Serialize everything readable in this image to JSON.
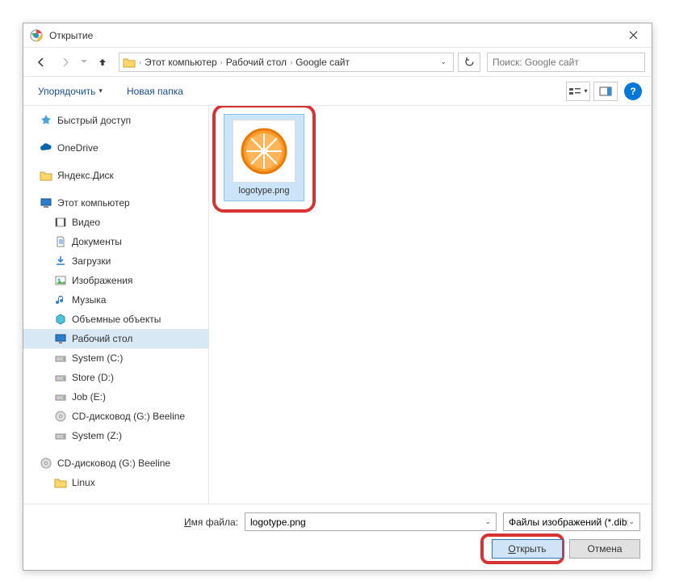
{
  "title": "Открытие",
  "breadcrumbs": [
    "Этот компьютер",
    "Рабочий стол",
    "Google сайт"
  ],
  "search_placeholder": "Поиск: Google сайт",
  "toolbar": {
    "organize": "Упорядочить",
    "new_folder": "Новая папка"
  },
  "sidebar": {
    "quick_access": "Быстрый доступ",
    "onedrive": "OneDrive",
    "yandex_disk": "Яндекс.Диск",
    "this_pc": "Этот компьютер",
    "videos": "Видео",
    "documents": "Документы",
    "downloads": "Загрузки",
    "pictures": "Изображения",
    "music": "Музыка",
    "objects3d": "Объемные объекты",
    "desktop": "Рабочий стол",
    "system_c": "System (C:)",
    "store_d": "Store (D:)",
    "job_e": "Job (E:)",
    "cd_g": "CD-дисковод (G:) Beeline",
    "system_z": "System (Z:)",
    "cd_g2": "CD-дисковод (G:) Beeline",
    "linux": "Linux"
  },
  "file": {
    "name": "logotype.png"
  },
  "footer": {
    "filename_label": "Имя файла:",
    "filename_value": "logotype.png",
    "filetype": "Файлы изображений (*.dib;*.jj",
    "open": "Открыть",
    "open_first": "О",
    "open_rest": "ткрыть",
    "cancel": "Отмена"
  }
}
